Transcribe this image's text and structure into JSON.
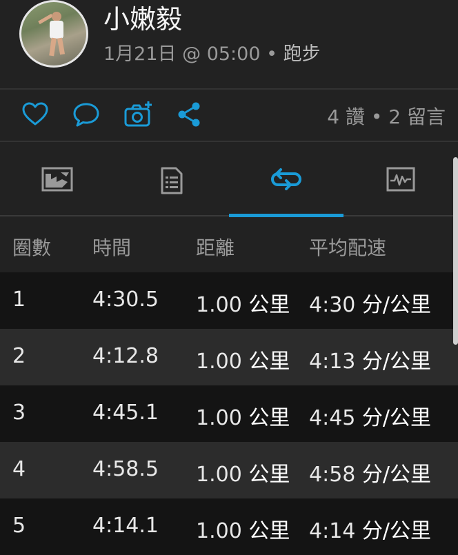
{
  "header": {
    "name": "小嫩毅",
    "date_time": "1月21日 @ 05:00",
    "separator": "•",
    "sport": "跑步"
  },
  "actions": {
    "icons": [
      "heart-icon",
      "comment-icon",
      "camera-add-icon",
      "share-icon"
    ],
    "likes": "4 讚",
    "dot": "•",
    "comments": "2 留言"
  },
  "tabs": [
    {
      "icon": "map-icon",
      "active": false
    },
    {
      "icon": "document-list-icon",
      "active": false
    },
    {
      "icon": "laps-repeat-icon",
      "active": true
    },
    {
      "icon": "chart-icon",
      "active": false
    }
  ],
  "colors": {
    "accent": "#1a9bd7",
    "background": "#222222"
  },
  "table": {
    "headers": [
      "圈數",
      "時間",
      "距離",
      "平均配速"
    ],
    "rows": [
      {
        "lap": "1",
        "time": "4:30.5",
        "distance": "1.00",
        "distance_unit": "公里",
        "pace": "4:30",
        "pace_unit": "分/公里"
      },
      {
        "lap": "2",
        "time": "4:12.8",
        "distance": "1.00",
        "distance_unit": "公里",
        "pace": "4:13",
        "pace_unit": "分/公里"
      },
      {
        "lap": "3",
        "time": "4:45.1",
        "distance": "1.00",
        "distance_unit": "公里",
        "pace": "4:45",
        "pace_unit": "分/公里"
      },
      {
        "lap": "4",
        "time": "4:58.5",
        "distance": "1.00",
        "distance_unit": "公里",
        "pace": "4:58",
        "pace_unit": "分/公里"
      },
      {
        "lap": "5",
        "time": "4:14.1",
        "distance": "1.00",
        "distance_unit": "公里",
        "pace": "4:14",
        "pace_unit": "分/公里"
      }
    ]
  }
}
